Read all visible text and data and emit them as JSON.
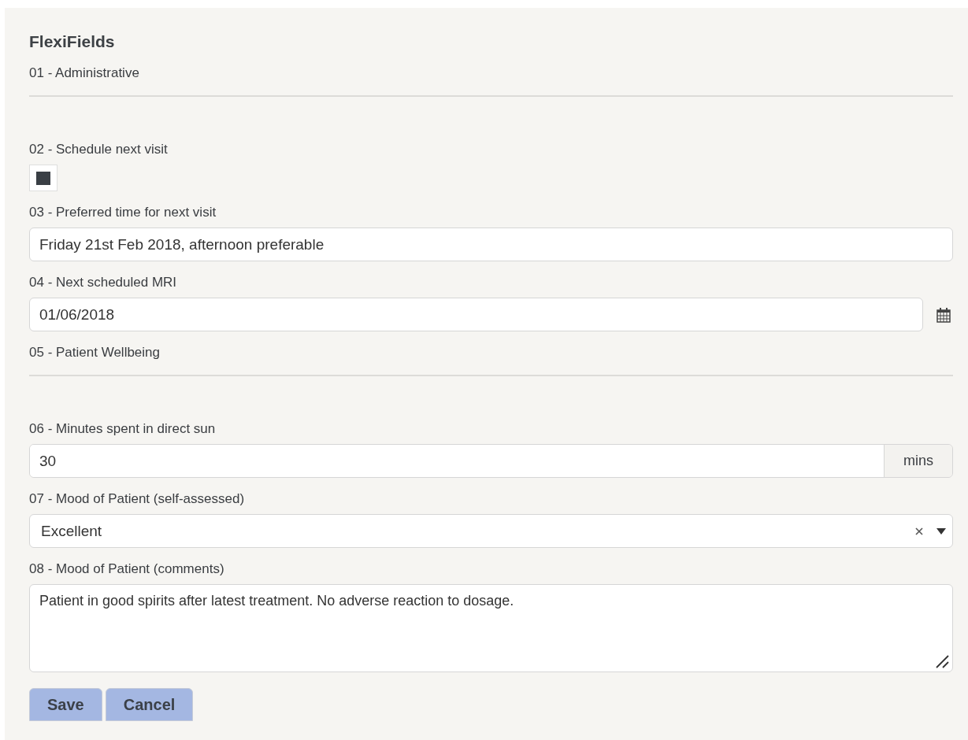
{
  "title": "FlexiFields",
  "fields": [
    {
      "kind": "section",
      "label": "01 - Administrative"
    },
    {
      "kind": "checkbox",
      "label": "02 - Schedule next visit",
      "checked": true
    },
    {
      "kind": "text",
      "label": "03 - Preferred time for next visit",
      "value": "Friday 21st Feb 2018, afternoon preferable"
    },
    {
      "kind": "date",
      "label": "04 - Next scheduled MRI",
      "value": "01/06/2018"
    },
    {
      "kind": "section",
      "label": "05 - Patient Wellbeing"
    },
    {
      "kind": "number",
      "label": "06 - Minutes spent in direct sun",
      "value": "30",
      "unit": "mins"
    },
    {
      "kind": "select",
      "label": "07 - Mood of Patient (self-assessed)",
      "value": "Excellent"
    },
    {
      "kind": "textarea",
      "label": "08 - Mood of Patient (comments)",
      "value": "Patient in good spirits after latest treatment. No adverse reaction to dosage."
    }
  ],
  "buttons": [
    "Save",
    "Cancel"
  ]
}
